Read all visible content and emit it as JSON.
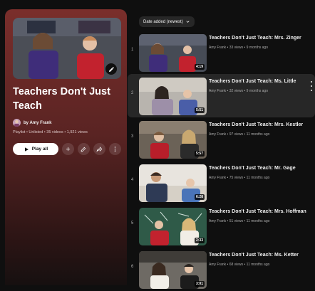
{
  "colors": {
    "panel_top": "#7a2e2b",
    "panel_bottom": "#161010",
    "background": "#0f0f0f"
  },
  "playlist": {
    "title": "Teachers Don't Just Teach",
    "owner": "by Amy Frank",
    "meta": "Playlist • Unlisted • 35 videos • 1,921 views",
    "play_all_label": "Play all",
    "icons": [
      "pencil-icon",
      "play-icon",
      "add-icon",
      "edit-icon",
      "share-icon",
      "more-vert-icon"
    ]
  },
  "sort": {
    "label": "Date added (newest)",
    "icon": "chevron-down-icon"
  },
  "videos": [
    {
      "index": "1",
      "title": "Teachers Don't Just Teach: Mrs. Zinger",
      "meta": "Amy Frank • 33 views • 9 months ago",
      "duration": "4:19"
    },
    {
      "index": "2",
      "title": "Teachers Don't Just Teach: Ms. Little",
      "meta": "Amy Frank • 32 views • 9 months ago",
      "duration": "5:51"
    },
    {
      "index": "3",
      "title": "Teachers Don't Just Teach: Mrs. Kestler",
      "meta": "Amy Frank • 97 views • 11 months ago",
      "duration": "5:57"
    },
    {
      "index": "4",
      "title": "Teachers Don't Just Teach: Mr. Gage",
      "meta": "Amy Frank • 75 views • 11 months ago",
      "duration": "6:28"
    },
    {
      "index": "5",
      "title": "Teachers Don't Just Teach: Mrs. Hoffman",
      "meta": "Amy Frank • 51 views • 11 months ago",
      "duration": "2:33"
    },
    {
      "index": "6",
      "title": "Teachers Don't Just Teach: Ms. Ketter",
      "meta": "Amy Frank • 68 views • 11 months ago",
      "duration": "3:01"
    }
  ]
}
